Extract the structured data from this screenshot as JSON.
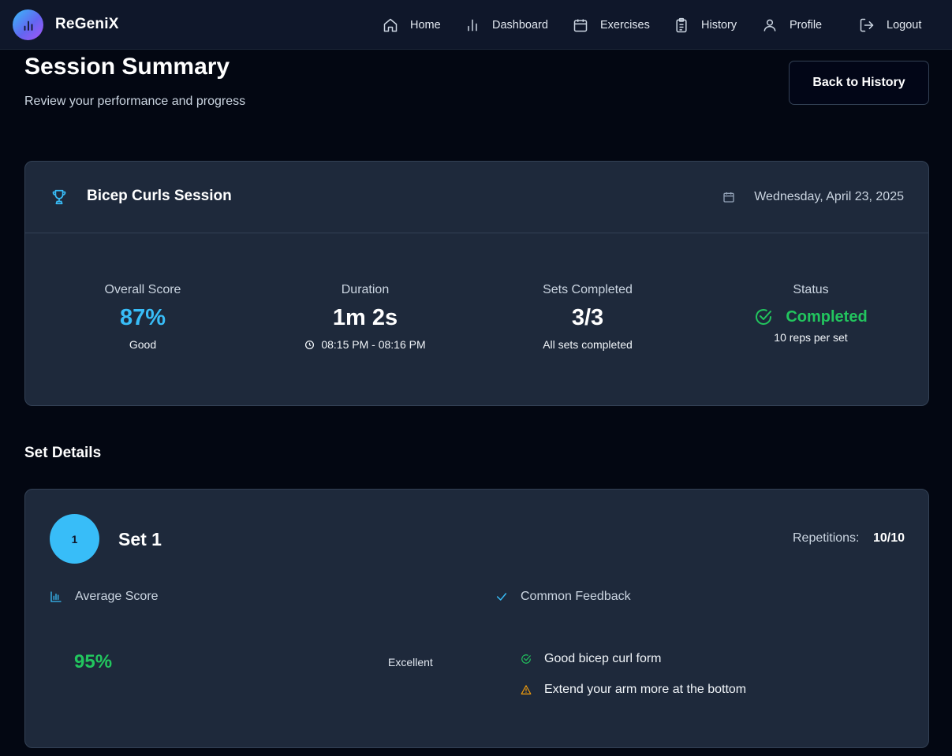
{
  "app": {
    "brand": "ReGeniX"
  },
  "nav": {
    "home": "Home",
    "dashboard": "Dashboard",
    "exercises": "Exercises",
    "history": "History",
    "profile": "Profile",
    "logout": "Logout"
  },
  "header": {
    "title": "Session Summary",
    "subtitle": "Review your performance and progress",
    "back_button": "Back to History"
  },
  "session": {
    "title": "Bicep Curls Session",
    "date": "Wednesday, April 23, 2025",
    "stats": {
      "score_label": "Overall Score",
      "score_value": "87%",
      "score_sub": "Good",
      "duration_label": "Duration",
      "duration_value": "1m 2s",
      "duration_sub": "08:15 PM - 08:16 PM",
      "sets_label": "Sets Completed",
      "sets_value": "3/3",
      "sets_sub": "All sets completed",
      "status_label": "Status",
      "status_value": "Completed",
      "status_sub": "10 reps per set"
    }
  },
  "set_details": {
    "title": "Set Details",
    "sets": [
      {
        "number": "1",
        "title": "Set 1",
        "reps_label": "Repetitions:",
        "reps_value": "10/10",
        "avg_label": "Average Score",
        "avg_value": "95%",
        "rating": "Excellent",
        "feedback_label": "Common Feedback",
        "feedback": [
          {
            "text": "Good bicep curl form",
            "type": "success"
          },
          {
            "text": "Extend your arm more at the bottom",
            "type": "warning"
          }
        ]
      }
    ]
  },
  "colors": {
    "background": "#030712",
    "card": "#1e293b",
    "accent": "#38bdf8",
    "success": "#22c55e",
    "warning": "#f59e0b"
  }
}
